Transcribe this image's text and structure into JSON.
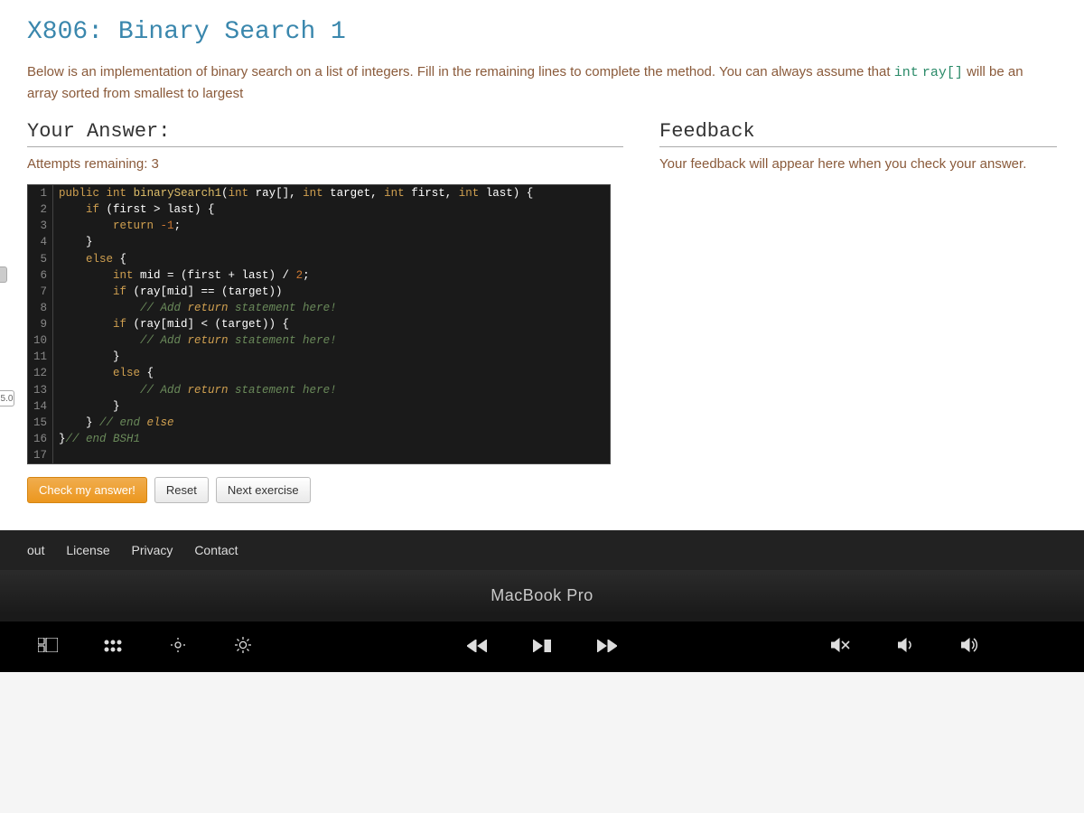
{
  "title": "X806: Binary Search 1",
  "prompt": {
    "text_before": "Below is an implementation of binary search on a list of integers. Fill in the remaining lines to complete the method. You can always assume that ",
    "code1": "int",
    "code2": "ray[]",
    "text_after": " will be an array sorted from smallest to largest"
  },
  "answer_heading": "Your Answer:",
  "feedback_heading": "Feedback",
  "attempts": "Attempts remaining: 3",
  "feedback_msg": "Your feedback will appear here when you check your answer.",
  "code_lines": [
    "public int binarySearch1(int ray[], int target, int first, int last) {",
    "    if (first > last) {",
    "        return -1;",
    "    }",
    "    else {",
    "        int mid = (first + last) / 2;",
    "        if (ray[mid] == (target))",
    "            // Add return statement here!",
    "        if (ray[mid] < (target)) {",
    "            // Add return statement here!",
    "        }",
    "        else {",
    "            // Add return statement here!",
    "        }",
    "    } // end else",
    "}// end BSH1",
    ""
  ],
  "buttons": {
    "check": "Check my answer!",
    "reset": "Reset",
    "next": "Next exercise"
  },
  "footer": {
    "about": "out",
    "license": "License",
    "privacy": "Privacy",
    "contact": "Contact"
  },
  "side_label": "5.0",
  "laptop": "MacBook Pro"
}
